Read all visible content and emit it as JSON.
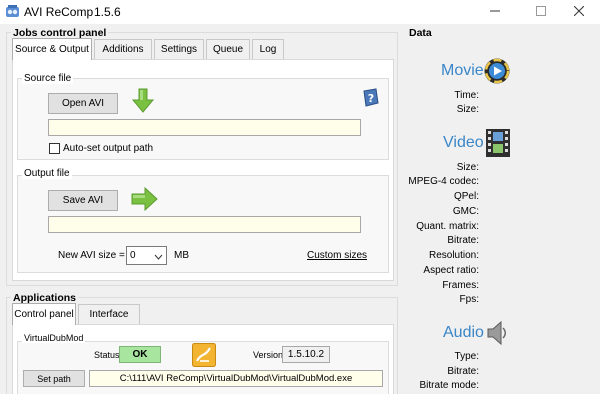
{
  "window": {
    "title": "AVI ReComp",
    "version": "1.5.6",
    "icons": [
      "app-icon",
      "minimize-icon",
      "maximize-icon",
      "close-icon"
    ]
  },
  "jobs": {
    "title": "Jobs control panel",
    "tabs": [
      {
        "label": "Source & Output",
        "active": true
      },
      {
        "label": "Additions",
        "active": false
      },
      {
        "label": "Settings",
        "active": false
      },
      {
        "label": "Queue",
        "active": false
      },
      {
        "label": "Log",
        "active": false
      }
    ],
    "source": {
      "title": "Source file",
      "open_label": "Open AVI",
      "path_value": "",
      "autoset_label": "Auto-set output path",
      "autoset_checked": false
    },
    "output": {
      "title": "Output file",
      "save_label": "Save AVI",
      "path_value": "",
      "size_label": "New AVI size =",
      "size_value": "0",
      "size_unit": "MB",
      "custom_sizes_label": "Custom sizes"
    }
  },
  "applications": {
    "title": "Applications",
    "tabs": [
      {
        "label": "Control panel",
        "active": true
      },
      {
        "label": "Interface",
        "active": false
      }
    ],
    "vdm": {
      "title": "VirtualDubMod",
      "status_label": "Status",
      "status_value": "OK",
      "version_label": "Version",
      "version_value": "1.5.10.2",
      "setpath_label": "Set path",
      "path_value": "C:\\111\\AVI ReComp\\VirtualDubMod\\VirtualDubMod.exe"
    }
  },
  "data_panel": {
    "title": "Data",
    "movie": {
      "title": "Movie",
      "labels": [
        "Time:",
        "Size:"
      ]
    },
    "video": {
      "title": "Video",
      "labels": [
        "Size:",
        "MPEG-4 codec:",
        "QPel:",
        "GMC:",
        "Quant. matrix:",
        "Bitrate:",
        "Resolution:",
        "Aspect ratio:",
        "Frames:",
        "Fps:"
      ]
    },
    "audio": {
      "title": "Audio",
      "labels": [
        "Type:",
        "Bitrate:",
        "Bitrate mode:"
      ]
    }
  },
  "colors": {
    "accent_blue": "#3a86c8",
    "status_green": "#a8e6a0",
    "path_field_bg": "#fffeeb",
    "arrow_green": "#7ac142"
  }
}
